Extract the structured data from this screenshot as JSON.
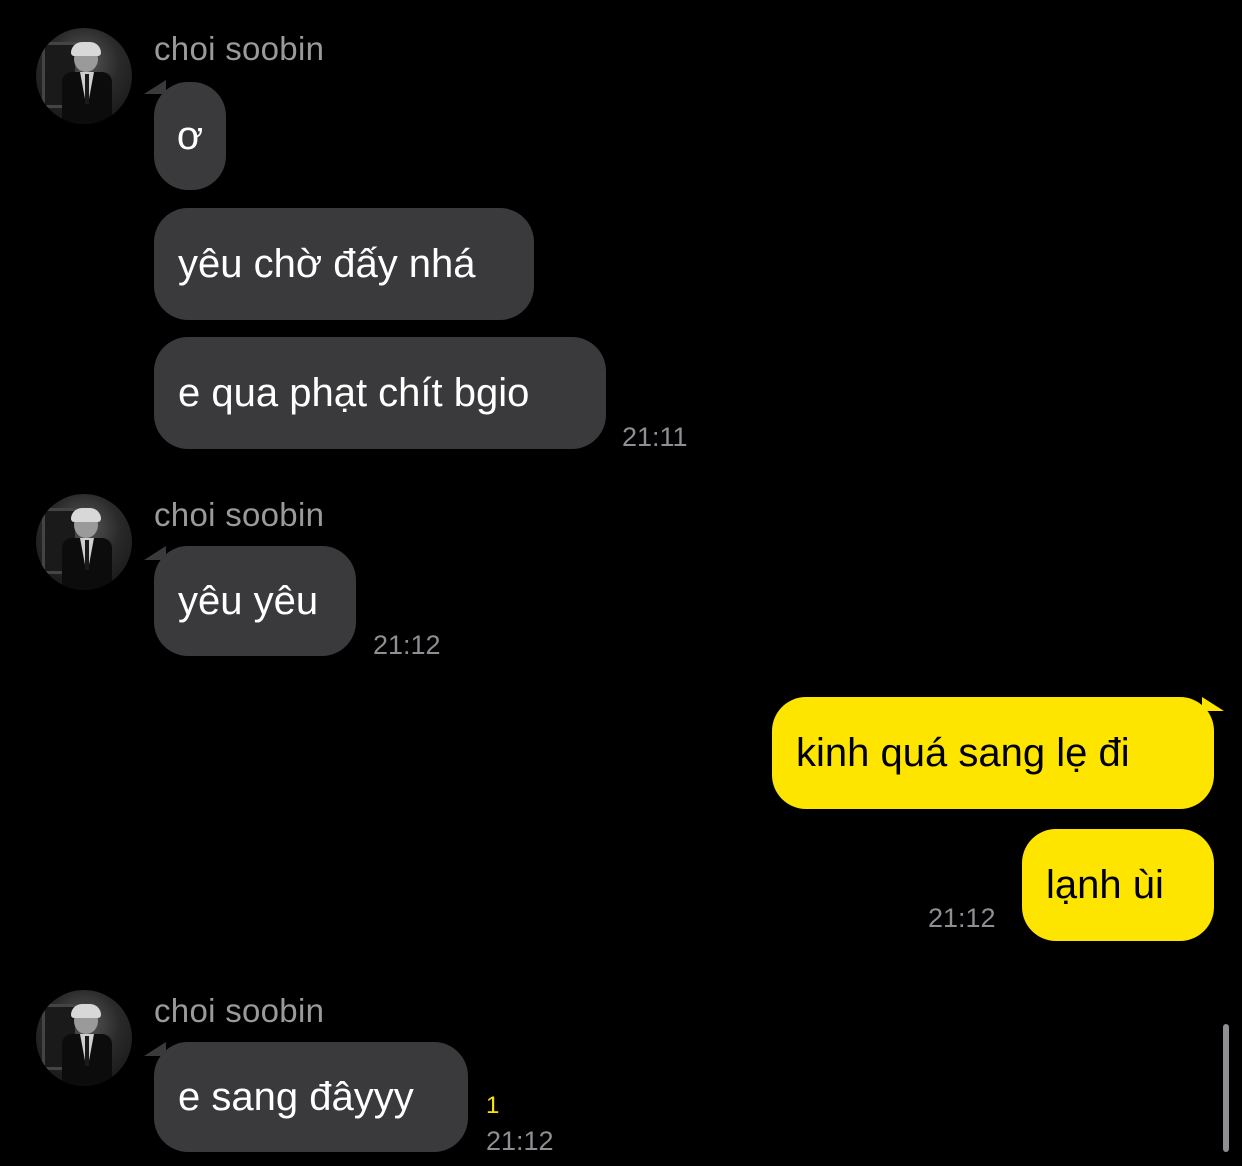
{
  "colors": {
    "background": "#000000",
    "incoming_bubble": "#3a3a3c",
    "outgoing_bubble": "#fee500",
    "timestamp": "#8e8e93",
    "sender_name": "#9a9a9a",
    "unread_count": "#fee500"
  },
  "groups": [
    {
      "sender": "choi soobin",
      "messages": [
        "ơ",
        "yêu chờ đấy nhá",
        "e qua phạt chít bgio"
      ],
      "time": "21:11"
    },
    {
      "sender": "choi soobin",
      "messages": [
        "yêu yêu"
      ],
      "time": "21:12"
    },
    {
      "sender": "me",
      "messages": [
        "kinh quá sang lẹ đi",
        "lạnh ùi"
      ],
      "time": "21:12"
    },
    {
      "sender": "choi soobin",
      "messages": [
        "e sang đâyyy"
      ],
      "unread": "1",
      "time": "21:12"
    }
  ]
}
